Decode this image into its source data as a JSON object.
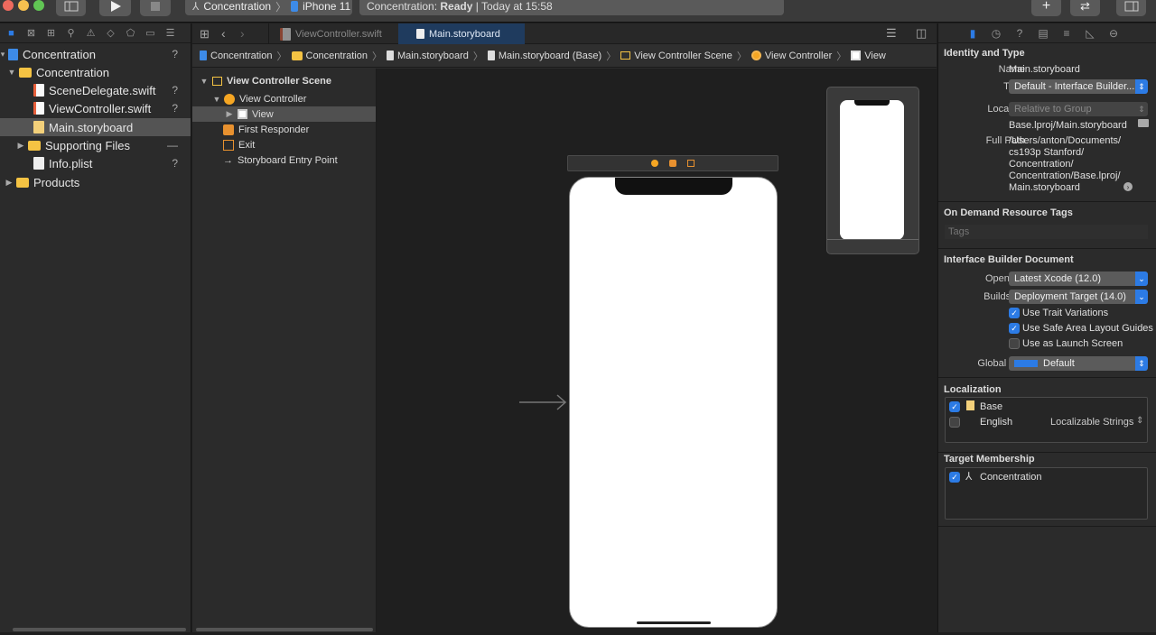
{
  "toolbar": {
    "scheme_target": "Concentration",
    "scheme_device": "iPhone 11",
    "activity_label": "Concentration: ",
    "activity_status": "Ready",
    "activity_time": " | Today at 15:58"
  },
  "navigator": {
    "items": [
      {
        "label": "Concentration",
        "badge": "?"
      },
      {
        "label": "Concentration",
        "badge": ""
      },
      {
        "label": "SceneDelegate.swift",
        "badge": "?"
      },
      {
        "label": "ViewController.swift",
        "badge": "?"
      },
      {
        "label": "Main.storyboard",
        "badge": ""
      },
      {
        "label": "Supporting Files",
        "badge": "—"
      },
      {
        "label": "Info.plist",
        "badge": "?"
      },
      {
        "label": "Products",
        "badge": ""
      }
    ]
  },
  "editor": {
    "tabs": [
      {
        "label": "ViewController.swift"
      },
      {
        "label": "Main.storyboard"
      }
    ],
    "jumpbar": [
      "Concentration",
      "Concentration",
      "Main.storyboard",
      "Main.storyboard (Base)",
      "View Controller Scene",
      "View Controller",
      "View"
    ]
  },
  "outline": {
    "scene": "View Controller Scene",
    "controller": "View Controller",
    "view": "View",
    "first_responder": "First Responder",
    "exit": "Exit",
    "entry": "Storyboard Entry Point"
  },
  "inspector": {
    "identity_header": "Identity and Type",
    "name_label": "Name",
    "name_value": "Main.storyboard",
    "type_label": "Type",
    "type_value": "Default - Interface Builder...",
    "location_label": "Location",
    "location_value": "Relative to Group",
    "location_path": "Base.lproj/Main.storyboard",
    "fullpath_label": "Full Path",
    "fullpath_lines": [
      "/Users/anton/Documents/",
      "cs193p Stanford/",
      "Concentration/",
      "Concentration/Base.lproj/",
      "Main.storyboard"
    ],
    "odr_header": "On Demand Resource Tags",
    "tags_placeholder": "Tags",
    "ibdoc_header": "Interface Builder Document",
    "opens_label": "Opens in",
    "opens_value": "Latest Xcode (12.0)",
    "builds_label": "Builds for",
    "builds_value": "Deployment Target (14.0)",
    "check_trait": "Use Trait Variations",
    "check_safe": "Use Safe Area Layout Guides",
    "check_launch": "Use as Launch Screen",
    "tint_label": "Global Tint",
    "tint_value": "Default",
    "tint_color": "#2c7be5",
    "localization_header": "Localization",
    "loc_base": "Base",
    "loc_english": "English",
    "loc_english_type": "Localizable Strings",
    "membership_header": "Target Membership",
    "membership_target": "Concentration"
  },
  "colors": {
    "accent": "#2c7be5",
    "folder": "#f5c343",
    "selection": "#545454"
  }
}
